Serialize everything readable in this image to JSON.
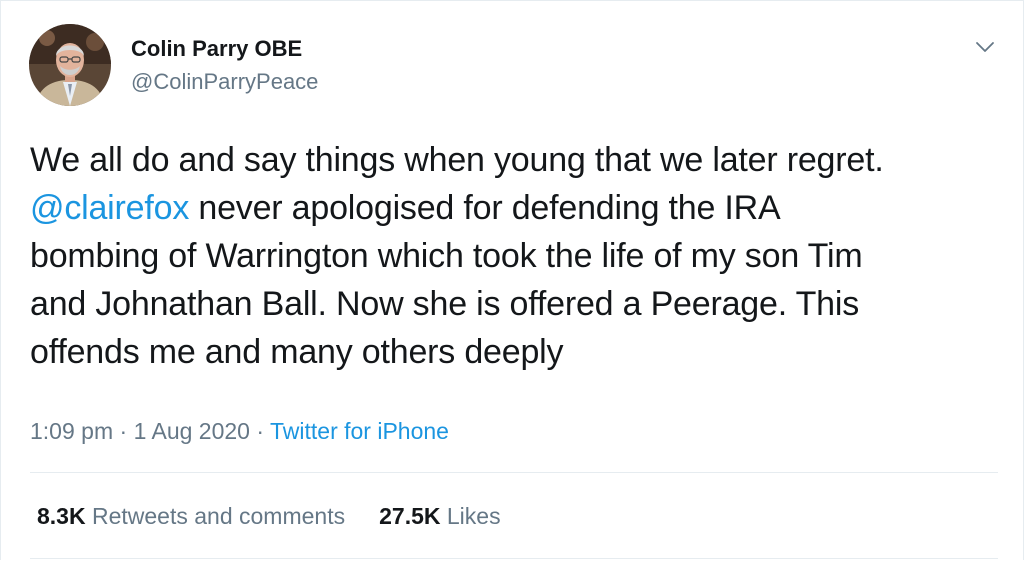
{
  "author": {
    "name": "Colin Parry OBE",
    "handle": "@ColinParryPeace",
    "avatar_icon": "profile-photo"
  },
  "menu": {
    "icon": "chevron-down-icon"
  },
  "tweet": {
    "line1": "We all do and say things when young that we later regret.",
    "mention": "@clairefox",
    "line2_rest": " never apologised for defending the IRA",
    "line3": "bombing of Warrington which took the life of my son Tim",
    "line4": "and Johnathan Ball. Now she is offered a Peerage. This",
    "line5": "offends me and many others deeply"
  },
  "meta": {
    "time": "1:09 pm",
    "sep1": " · ",
    "date": "1 Aug 2020",
    "sep2": " · ",
    "source": "Twitter for iPhone"
  },
  "stats": {
    "retweets_count": "8.3K",
    "retweets_label": " Retweets and comments",
    "likes_count": "27.5K",
    "likes_label": " Likes"
  },
  "colors": {
    "text": "#14171a",
    "secondary": "#657786",
    "link": "#1b95e0",
    "divider": "#e6ecf0"
  }
}
